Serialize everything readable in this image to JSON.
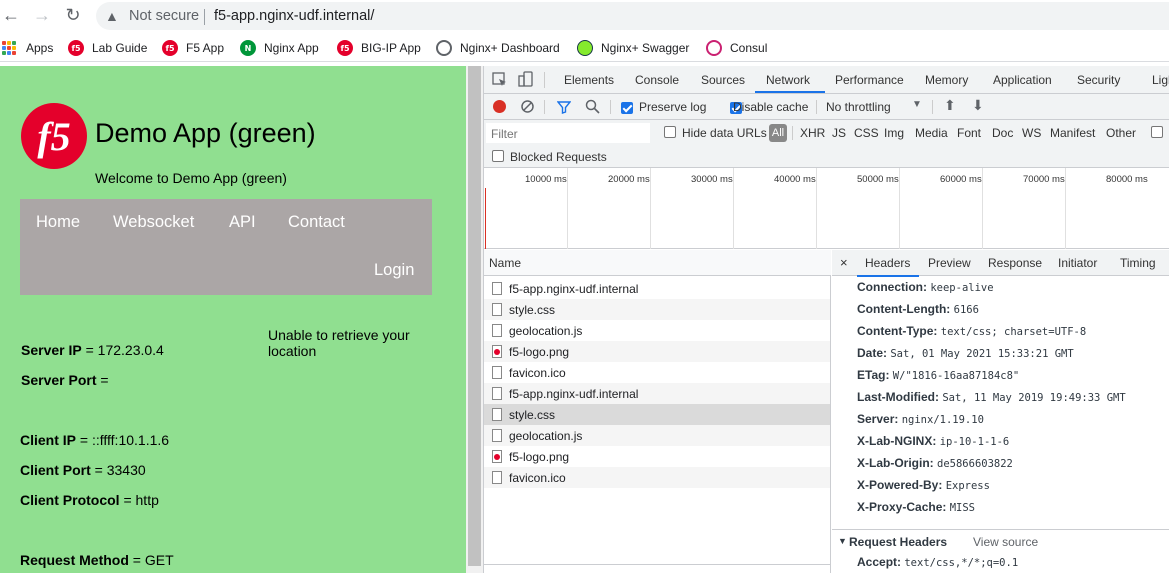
{
  "browser": {
    "security_label": "Not secure",
    "url": "f5-app.nginx-udf.internal/",
    "bookmarks": [
      {
        "label": "Apps",
        "icon": "apps-grid-icon"
      },
      {
        "label": "Lab Guide",
        "icon": "f5-icon"
      },
      {
        "label": "F5 App",
        "icon": "f5-icon"
      },
      {
        "label": "Nginx App",
        "icon": "nginx-icon"
      },
      {
        "label": "BIG-IP App",
        "icon": "f5-icon"
      },
      {
        "label": "Nginx+ Dashboard",
        "icon": "globe-icon"
      },
      {
        "label": "Nginx+ Swagger",
        "icon": "swagger-icon"
      },
      {
        "label": "Consul",
        "icon": "consul-icon"
      }
    ]
  },
  "page": {
    "title": "Demo App (green)",
    "welcome": "Welcome to Demo App (green)",
    "menu": [
      "Home",
      "Websocket",
      "API",
      "Contact",
      "Login"
    ],
    "location_msg": "Unable to retrieve your location",
    "server_ip_label": "Server IP",
    "server_ip": "= 172.23.0.4",
    "server_port_label": "Server Port",
    "server_port": "=",
    "client_ip_label": "Client IP",
    "client_ip": "= ::ffff:10.1.1.6",
    "client_port_label": "Client Port",
    "client_port": "= 33430",
    "client_protocol_label": "Client Protocol",
    "client_protocol": "= http",
    "request_method_label": "Request Method",
    "request_method": "= GET",
    "bg_color": "#90df90"
  },
  "devtools": {
    "tabs": [
      "Elements",
      "Console",
      "Sources",
      "Network",
      "Performance",
      "Memory",
      "Application",
      "Security",
      "Ligh"
    ],
    "active_tab": "Network",
    "preserve_log": "Preserve log",
    "disable_cache": "Disable cache",
    "throttling": "No throttling",
    "filter_placeholder": "Filter",
    "hide_data_urls": "Hide data URLs",
    "all": "All",
    "types": [
      "XHR",
      "JS",
      "CSS",
      "Img",
      "Media",
      "Font",
      "Doc",
      "WS",
      "Manifest",
      "Other"
    ],
    "blocked_requests": "Blocked Requests",
    "timeline_ticks": [
      "10000 ms",
      "20000 ms",
      "30000 ms",
      "40000 ms",
      "50000 ms",
      "60000 ms",
      "70000 ms",
      "80000 ms"
    ],
    "name_header": "Name",
    "requests": [
      {
        "name": "f5-app.nginx-udf.internal",
        "type": "doc"
      },
      {
        "name": "style.css",
        "type": "doc"
      },
      {
        "name": "geolocation.js",
        "type": "doc"
      },
      {
        "name": "f5-logo.png",
        "type": "img"
      },
      {
        "name": "favicon.ico",
        "type": "doc"
      },
      {
        "name": "f5-app.nginx-udf.internal",
        "type": "doc"
      },
      {
        "name": "style.css",
        "type": "doc"
      },
      {
        "name": "geolocation.js",
        "type": "doc"
      },
      {
        "name": "f5-logo.png",
        "type": "img"
      },
      {
        "name": "favicon.ico",
        "type": "doc"
      }
    ],
    "detail_tabs": [
      "Headers",
      "Preview",
      "Response",
      "Initiator",
      "Timing"
    ],
    "active_detail_tab": "Headers",
    "response_headers": [
      {
        "k": "Connection:",
        "v": "keep-alive"
      },
      {
        "k": "Content-Length:",
        "v": "6166"
      },
      {
        "k": "Content-Type:",
        "v": "text/css; charset=UTF-8"
      },
      {
        "k": "Date:",
        "v": "Sat, 01 May 2021 15:33:21 GMT"
      },
      {
        "k": "ETag:",
        "v": "W/\"1816-16aa87184c8\""
      },
      {
        "k": "Last-Modified:",
        "v": "Sat, 11 May 2019 19:49:33 GMT"
      },
      {
        "k": "Server:",
        "v": "nginx/1.19.10"
      },
      {
        "k": "X-Lab-NGINX:",
        "v": "ip-10-1-1-6"
      },
      {
        "k": "X-Lab-Origin:",
        "v": "de5866603822"
      },
      {
        "k": "X-Powered-By:",
        "v": "Express"
      },
      {
        "k": "X-Proxy-Cache:",
        "v": "MISS"
      }
    ],
    "request_headers_title": "Request Headers",
    "view_source": "View source",
    "accept_key": "Accept:",
    "accept_val": "text/css,*/*;q=0.1",
    "accent": "#1a73e8",
    "record_color": "#d93025"
  }
}
